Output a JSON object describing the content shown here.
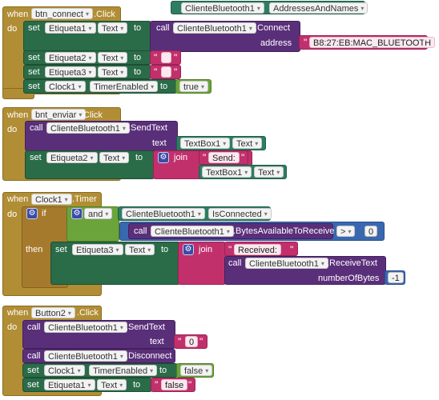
{
  "kw": {
    "when": "when",
    "do": "do",
    "set": "set",
    "to": "to",
    "call": "call",
    "if": "if",
    "then": "then",
    "and": "and",
    "join": "join",
    "text": "text",
    "address": "address",
    "numberOfBytes": "numberOfBytes",
    "click": ".Click",
    "timer": ".Timer",
    "connect": ".Connect",
    "sendText": ".SendText",
    "bytesAvail": ".BytesAvailableToReceive",
    "receiveText": ".ReceiveText",
    "disconnect": ".Disconnect",
    "isConnected": "IsConnected",
    "addressesAndNames": "AddressesAndNames",
    "gear": "⚙",
    "quote": "\""
  },
  "components": {
    "btn_connect": "btn_connect",
    "bnt_enviar": "bnt_enviar",
    "clock1": "Clock1",
    "button2": "Button2",
    "cliente": "ClienteBluetooth1",
    "etiqueta1": "Etiqueta1",
    "etiqueta2": "Etiqueta2",
    "etiqueta3": "Etiqueta3",
    "textbox1": "TextBox1"
  },
  "props": {
    "text": "Text",
    "timerEnabled": "TimerEnabled"
  },
  "values": {
    "mac": "B8:27:EB:MAC_BLUETOOTH",
    "true": "true",
    "false": "false",
    "send": "Send:",
    "received": "Received:",
    "empty": "",
    "zero": "0",
    "gt": ">",
    "minus1": "-1",
    "zeroNum": "0"
  },
  "icons": {
    "dropdown": "▾"
  }
}
